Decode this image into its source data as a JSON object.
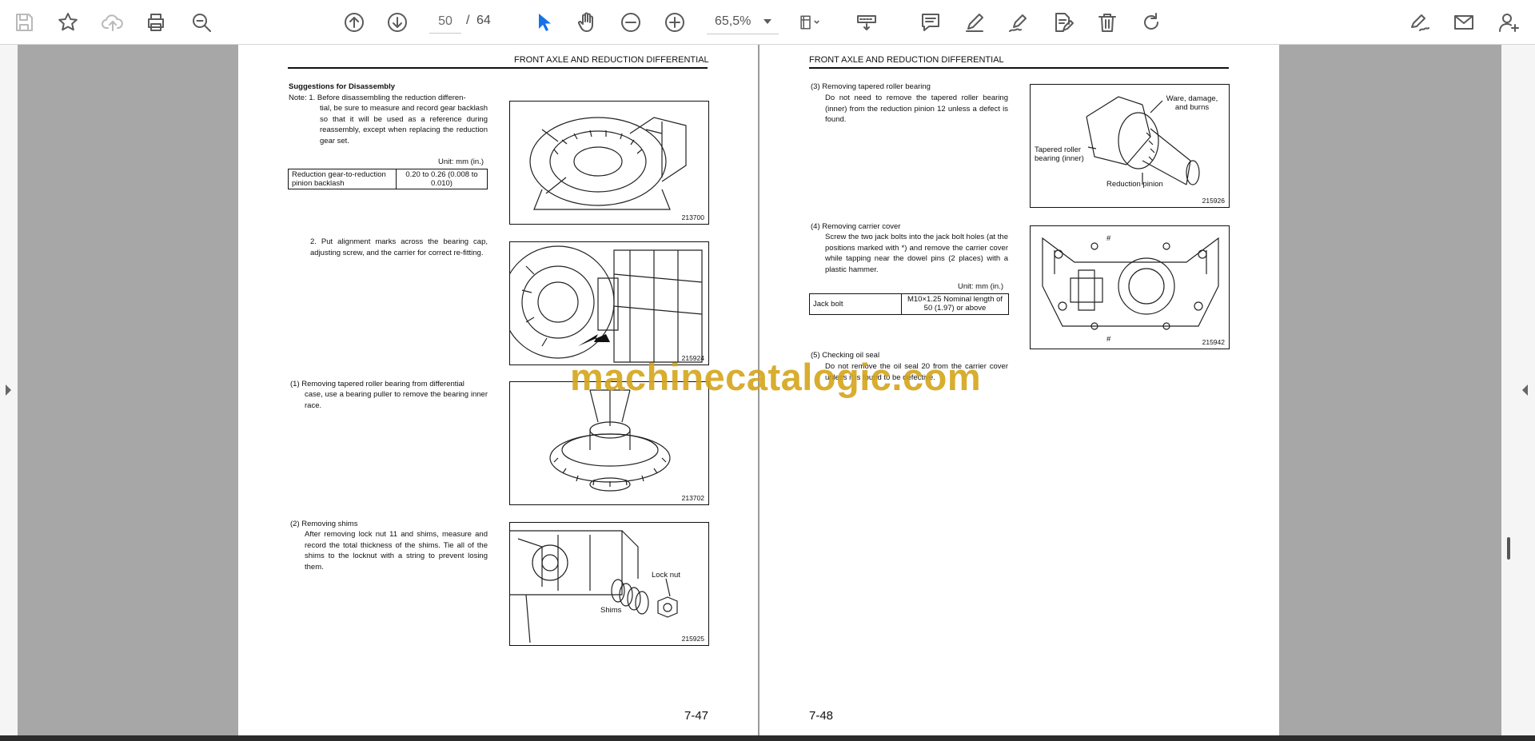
{
  "toolbar": {
    "page_current": "50",
    "page_separator": "/",
    "page_total": "64",
    "zoom": "65,5%"
  },
  "left_page": {
    "header": "FRONT AXLE AND REDUCTION DIFFERENTIAL",
    "section_title": "Suggestions for Disassembly",
    "note1": "Note: 1. Before disassembling the reduction differen-",
    "note1_cont": "tial, be sure to measure and record gear backlash so that it will be used as a reference during reassembly, except when replacing the reduction gear set.",
    "unit": "Unit: mm (in.)",
    "table": {
      "label": "Reduction gear-to-reduction pinion backlash",
      "value": "0.20 to 0.26 (0.008 to 0.010)"
    },
    "note2": "2. Put alignment marks across the bearing cap, adjusting screw, and the carrier for correct re-fitting.",
    "item1_title": "(1)  Removing tapered roller bearing from differential",
    "item1_body": "case, use a bearing puller to remove the bearing inner race.",
    "item2_title": "(2)  Removing shims",
    "item2_body": "After removing lock nut 11 and shims, measure and record the total thickness of the shims. Tie all of the shims to the locknut with a string to prevent losing them.",
    "fig1_id": "213700",
    "fig2_id": "215924",
    "fig3_id": "213702",
    "fig4_id": "215925",
    "fig4_label_locknut": "Lock nut",
    "fig4_label_shims": "Shims",
    "page_number": "7-47"
  },
  "right_page": {
    "header": "FRONT AXLE AND REDUCTION DIFFERENTIAL",
    "item3_title": "(3)  Removing tapered roller bearing",
    "item3_body": "Do not need to remove the tapered roller bearing (inner) from the reduction pinion 12 unless a defect is found.",
    "item4_title": "(4)  Removing carrier cover",
    "item4_body": "Screw the two jack bolts into the jack bolt holes (at the positions marked with *) and remove the carrier cover while tapping near the dowel pins (2 places) with a plastic hammer.",
    "unit": "Unit: mm (in.)",
    "table": {
      "label": "Jack bolt",
      "value": "M10×1.25 Nominal length of 50 (1.97) or above"
    },
    "item5_title": "(5)  Checking oil seal",
    "item5_body": "Do not remove the oil seal 20 from the carrier cover unless it is found to be defective.",
    "fig5_id": "215926",
    "fig5_label_wear": "Ware, damage, and burns",
    "fig5_label_bearing": "Tapered roller bearing (inner)",
    "fig5_label_pinion": "Reduction pinion",
    "fig6_id": "215942",
    "fig6_mark": "#",
    "page_number": "7-48"
  },
  "watermark": "machinecatalogic.com",
  "icons": [
    "save-icon",
    "bookmark-star-icon",
    "cloud-upload-icon",
    "print-icon",
    "zoom-search-icon",
    "arrow-up-circle-icon",
    "arrow-down-circle-icon",
    "select-cursor-icon",
    "hand-icon",
    "zoom-out-icon",
    "zoom-in-icon",
    "fit-page-icon",
    "keyboard-icon",
    "comment-icon",
    "pen-icon",
    "sign-icon",
    "edit-pdf-icon",
    "delete-icon",
    "rotate-icon",
    "fill-sign-icon",
    "email-icon",
    "share-user-icon"
  ]
}
